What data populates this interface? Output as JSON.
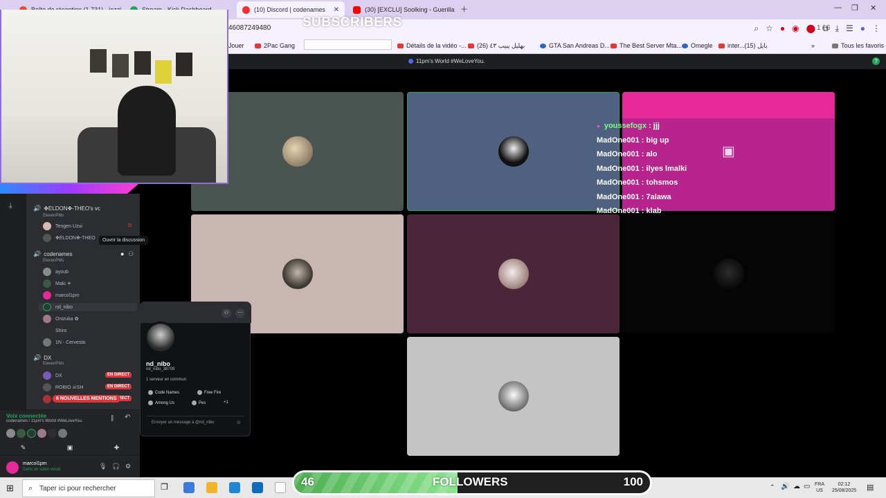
{
  "browser": {
    "tabs": [
      {
        "label": "Boîte de réception (1 731) - jozzi",
        "color": "#e74c3c"
      },
      {
        "label": "Stream - Kick Dashboard",
        "color": "#23a55a"
      },
      {
        "label": "(10) Discord | codenames",
        "color": "#ff2a2a"
      },
      {
        "label": "(30) [EXCLU] Soolking - Guerilla",
        "color": "#ff0000"
      }
    ],
    "url": "46087249480",
    "search_counter": "1 / 6",
    "bookmarks": [
      {
        "label": "Jouer",
        "type": "grey"
      },
      {
        "label": "2Pac Gang",
        "type": "red"
      },
      {
        "label": "Détails de la vidéo -...",
        "type": "red"
      },
      {
        "label": "بهليل يبيب ٤٣ (26)",
        "type": "red"
      },
      {
        "label": "GTA San Andreas D...",
        "type": "blue"
      },
      {
        "label": "The Best Server Mta...",
        "type": "red"
      },
      {
        "label": "Omegle",
        "type": "blue"
      },
      {
        "label": "inter...بايل (15)",
        "type": "red"
      },
      {
        "label": "Tous les favoris",
        "type": "grey"
      }
    ]
  },
  "overlay": {
    "subscribers_label": "SUBSCRIBERS",
    "followers_label": "FOLLOWERS",
    "followers_current": "46",
    "followers_goal": "100",
    "followers_progress_fraction": 0.46
  },
  "discord": {
    "server_title": "11pm's World #WeLoveYou.",
    "channels": [
      {
        "name": "✥ELDON✥-THEO's vc",
        "owner": "ElevenPMs"
      },
      {
        "name": "codenames",
        "owner": "ElevenPMs"
      },
      {
        "name": "DX",
        "owner": "ElevenPMs"
      }
    ],
    "vc_members": [
      "Tengen Uzui",
      "✥ELDON✥-THEO"
    ],
    "codenames_members": [
      "ayoub",
      "Maki ☀",
      "marcol1pm",
      "nd_nibo",
      "Onizuka ✿",
      "Shiro",
      "1N - Cervesta"
    ],
    "dx_members": [
      {
        "name": "DX",
        "live": "EN DIRECT"
      },
      {
        "name": "ROBIO ☠SH",
        "live": "EN DIRECT"
      },
      {
        "name": "",
        "live": "EN DIRECT"
      }
    ],
    "tooltip": "Ouvrir la discussion",
    "mentions_badge": "6 NOUVELLES MENTIONS",
    "voice": {
      "status": "Voix connectée",
      "location": "codenames / 11pm's World #WeLoveYou."
    },
    "user": {
      "name": "marcol1pm",
      "status": "Dans un salon vocal"
    },
    "profile": {
      "display_name": "nd_nibo",
      "username": "nd_nibo_38709",
      "mutual": "1 serveur en commun",
      "activities": [
        "Code Names",
        "Free Fire",
        "Among Us",
        "Pes"
      ],
      "activities_more": "+1",
      "message_placeholder": "Envoyer un message à @nd_nibo"
    }
  },
  "chat": [
    {
      "user": "youssefogx",
      "text": "jjj",
      "color": "#7dff8a"
    },
    {
      "user": "MadOne001",
      "text": "big up",
      "color": "#ffffff"
    },
    {
      "user": "MadOne001",
      "text": "alo",
      "color": "#ffffff"
    },
    {
      "user": "MadOne001",
      "text": "ilyes lmalki",
      "color": "#ffffff"
    },
    {
      "user": "MadOne001",
      "text": "tohsmos",
      "color": "#ffffff"
    },
    {
      "user": "MadOne001",
      "text": "7alawa",
      "color": "#ffffff"
    },
    {
      "user": "MadOne001",
      "text": "klab",
      "color": "#ffffff"
    }
  ],
  "taskbar": {
    "search_placeholder": "Taper ici pour rechercher",
    "lang": "FRA",
    "region": "US",
    "time": "02:12",
    "date": "25/08/2025"
  },
  "colors": {
    "discord_bg": "#000000",
    "live_red": "#da373c",
    "accent_pink": "#e8299a",
    "progress_green": "#4caf50"
  }
}
